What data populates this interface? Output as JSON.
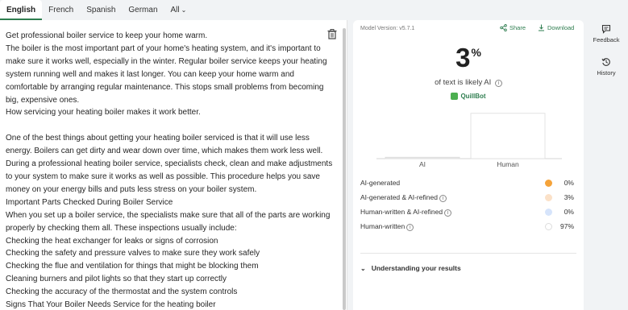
{
  "tabs": [
    {
      "label": "English",
      "active": true
    },
    {
      "label": "French"
    },
    {
      "label": "Spanish"
    },
    {
      "label": "German"
    },
    {
      "label": "All"
    }
  ],
  "editor": {
    "lines": [
      "Get professional boiler service to keep your home warm.",
      "The boiler is the most important part of your home's heating system, and it's important to",
      "make sure it works well, especially in the winter. Regular boiler service keeps your heating",
      "system running well and makes it last longer. You can keep your home warm and",
      "comfortable by arranging regular maintenance. This stops small problems from becoming",
      "big, expensive ones.",
      "How servicing your heating boiler makes it work better.",
      "",
      "One of the best things about getting your heating boiler serviced is that it will use less",
      "energy. Boilers can get dirty and wear down over time, which makes them work less well.",
      "During a professional heating boiler service, specialists check, clean and make adjustments",
      "to your system to make sure it works as well as possible. This procedure helps you save",
      "money on your energy bills and puts less stress on your boiler system.",
      "Important Parts Checked During Boiler Service",
      "When you set up a boiler service, the specialists make sure that all of the parts are working",
      "properly by checking them all. These inspections usually include:",
      "Checking the heat exchanger for leaks or signs of corrosion",
      "Checking the safety and pressure valves to make sure they work safely",
      "Checking the flue and ventilation for things that might be blocking them",
      "Cleaning burners and pilot lights so that they start up correctly",
      "Checking the accuracy of the thermostat and the system controls",
      "Signs That Your Boiler Needs Service for the heating boiler"
    ]
  },
  "results": {
    "model_version": "Model Version: v5.7.1",
    "share_label": "Share",
    "download_label": "Download",
    "percent_value": "3",
    "percent_sign": "%",
    "likely_text": "of text is likely AI",
    "brand": "QuillBot",
    "understanding_label": "Understanding your results"
  },
  "chart_data": {
    "type": "bar",
    "categories": [
      "AI",
      "Human"
    ],
    "values": [
      3,
      97
    ],
    "ylim": [
      0,
      100
    ],
    "colors": [
      "#e8e8e8",
      "#ffffff"
    ]
  },
  "legend": [
    {
      "label": "AI-generated",
      "value": "0%",
      "color": "#f5a33a",
      "info": false
    },
    {
      "label": "AI-generated & AI-refined",
      "value": "3%",
      "color": "#fbe1c8",
      "info": true
    },
    {
      "label": "Human-written & AI-refined",
      "value": "0%",
      "color": "#d6e4fb",
      "info": true
    },
    {
      "label": "Human-written",
      "value": "97%",
      "color": "#ffffff",
      "info": true
    }
  ],
  "side": {
    "feedback_label": "Feedback",
    "history_label": "History"
  },
  "colors": {
    "accent": "#2e7d4f"
  }
}
